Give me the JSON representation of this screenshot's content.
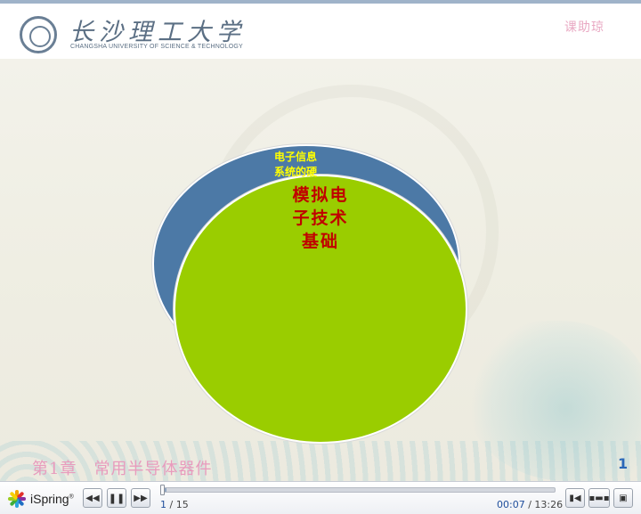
{
  "slide": {
    "university_cn": "长沙理工大学",
    "university_en": "CHANGSHA UNIVERSITY OF SCIENCE & TECHNOLOGY",
    "course_tag": "课助琼",
    "chapter_title": "第1章　常用半导体器件",
    "slide_number": "1",
    "diagram": {
      "outer_label_lines": [
        "电子信息",
        "系统的硬"
      ],
      "inner_label_lines": [
        "模拟电",
        "子技术",
        "基础"
      ]
    }
  },
  "player": {
    "logo_text": "iSpring",
    "logo_mark": "®",
    "buttons": {
      "prev_icon": "prev-icon",
      "pause_icon": "pause-icon",
      "next_icon": "next-icon",
      "volume_icon": "volume-icon",
      "layout_icon": "layout-icon",
      "fullscreen_icon": "fullscreen-icon"
    },
    "current_slide": "1",
    "total_slides": "/ 15",
    "elapsed": "00:07",
    "duration": "/ 13:26",
    "progress": 0.009
  },
  "colors": {
    "outer_circle": "#4c79a6",
    "inner_circle": "#9acd00",
    "outer_text": "#ffff00",
    "inner_text": "#c00000",
    "slide_number": "#2a68b8",
    "chapter_title": "#e89bbd"
  }
}
